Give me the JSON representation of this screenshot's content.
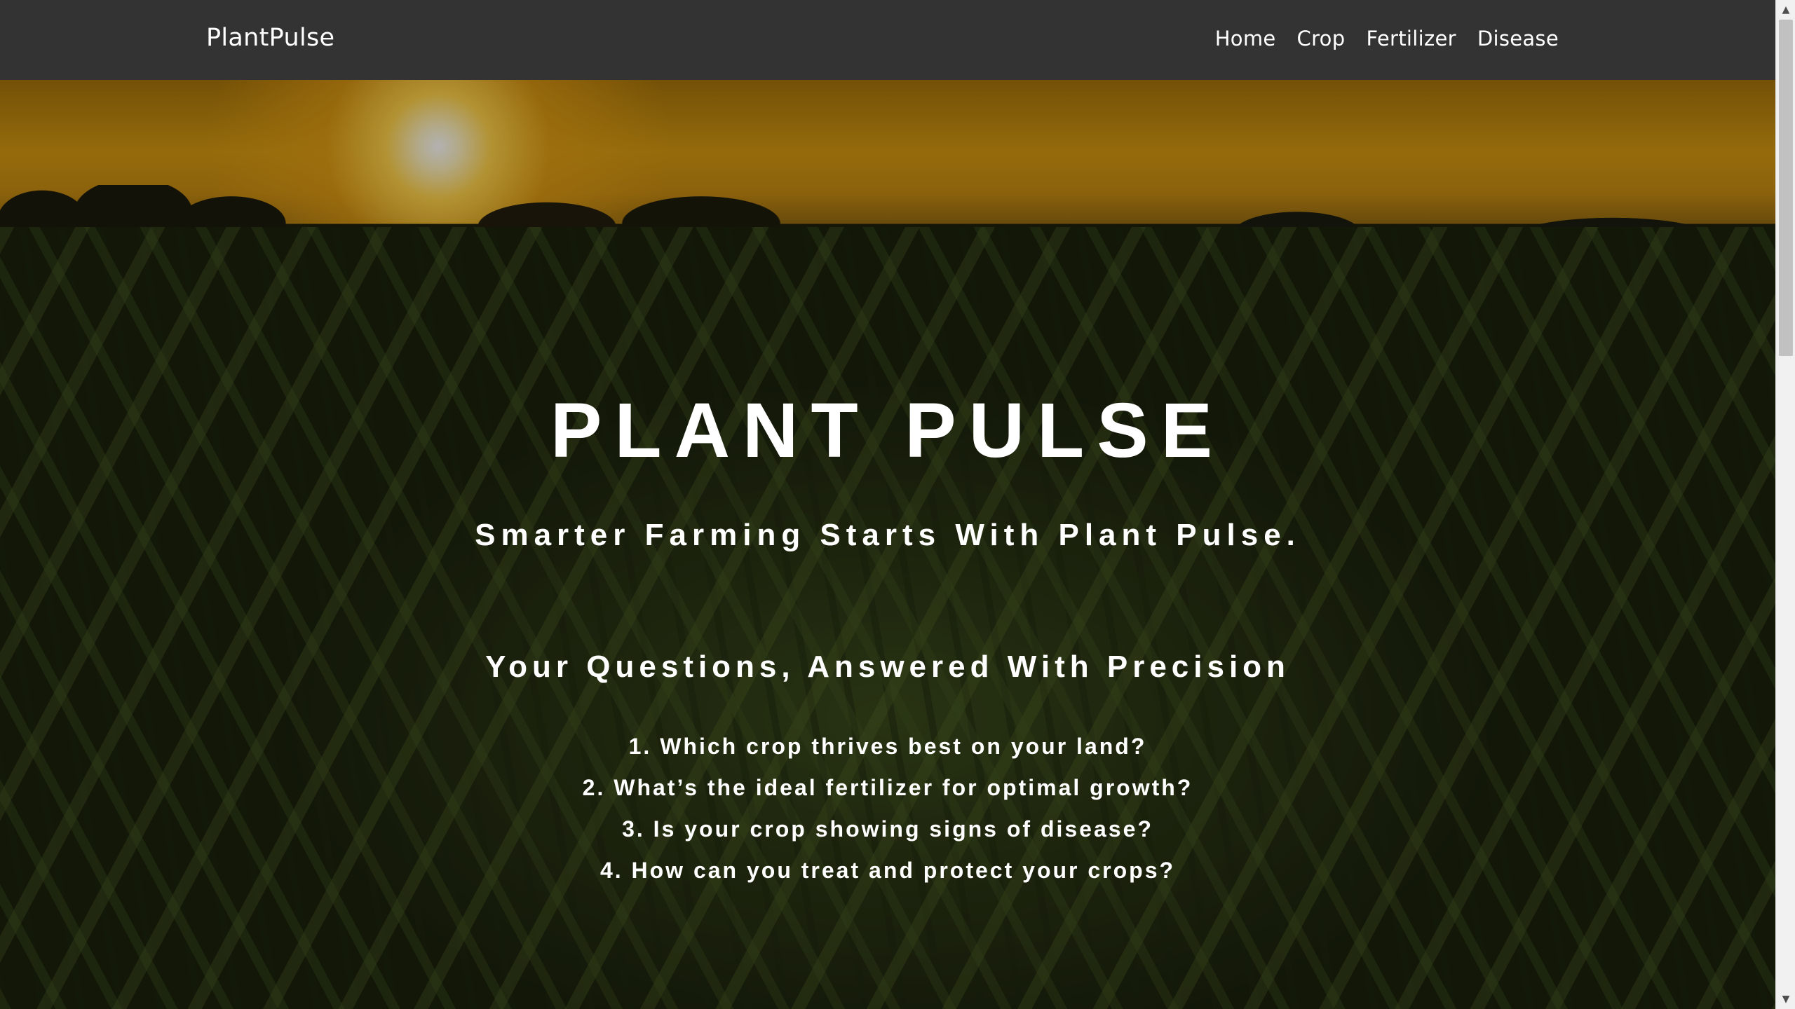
{
  "navbar": {
    "brand": "PlantPulse",
    "links": [
      {
        "label": "Home"
      },
      {
        "label": "Crop"
      },
      {
        "label": "Fertilizer"
      },
      {
        "label": "Disease"
      }
    ]
  },
  "hero": {
    "title": "PLANT PULSE",
    "subtitle": "Smarter Farming Starts With Plant Pulse.",
    "questions_heading": "Your Questions, Answered With Precision",
    "questions": [
      "1. Which crop thrives best on your land?",
      "2. What’s the ideal fertilizer for optimal growth?",
      "3. Is your crop showing signs of disease?",
      "4. How can you treat and protect your crops?"
    ]
  },
  "scrollbar": {
    "up_icon": "▲",
    "down_icon": "▼"
  },
  "colors": {
    "navbar_bg": "#333333",
    "text": "#ffffff",
    "sky_accent": "#d59a11"
  }
}
